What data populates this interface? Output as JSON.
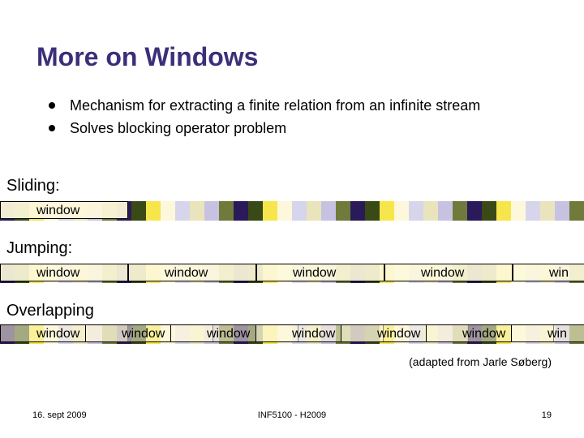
{
  "title": "More on Windows",
  "bullets": [
    "Mechanism for extracting a finite relation from an infinite stream",
    "Solves blocking operator problem"
  ],
  "sections": {
    "sliding": "Sliding:",
    "jumping": "Jumping:",
    "overlapping": "Overlapping"
  },
  "window_label": "window",
  "window_label_short": "win",
  "attribution": "(adapted from Jarle Søberg)",
  "footer": {
    "left": "16. sept 2009",
    "center": "INF5100 - H2009",
    "right": "19"
  },
  "palette": {
    "dark_purple": "#2b1a5a",
    "dark_green": "#3a4a16",
    "yellow": "#f7e64b",
    "ivory": "#fdf8db",
    "lilac": "#d7d5ec",
    "beige": "#e9e4bb",
    "pale_purple": "#c7c2e2",
    "olive": "#707a3a"
  },
  "stream": [
    "dark_purple",
    "dark_green",
    "yellow",
    "ivory",
    "lilac",
    "beige",
    "pale_purple",
    "olive",
    "dark_purple",
    "dark_green",
    "yellow",
    "ivory",
    "lilac",
    "beige",
    "pale_purple",
    "olive",
    "dark_purple",
    "dark_green",
    "yellow",
    "ivory",
    "lilac",
    "beige",
    "pale_purple",
    "olive",
    "dark_purple",
    "dark_green",
    "yellow",
    "ivory",
    "lilac",
    "beige",
    "pale_purple",
    "olive",
    "dark_purple",
    "dark_green",
    "yellow",
    "ivory",
    "lilac",
    "beige",
    "pale_purple",
    "olive"
  ]
}
